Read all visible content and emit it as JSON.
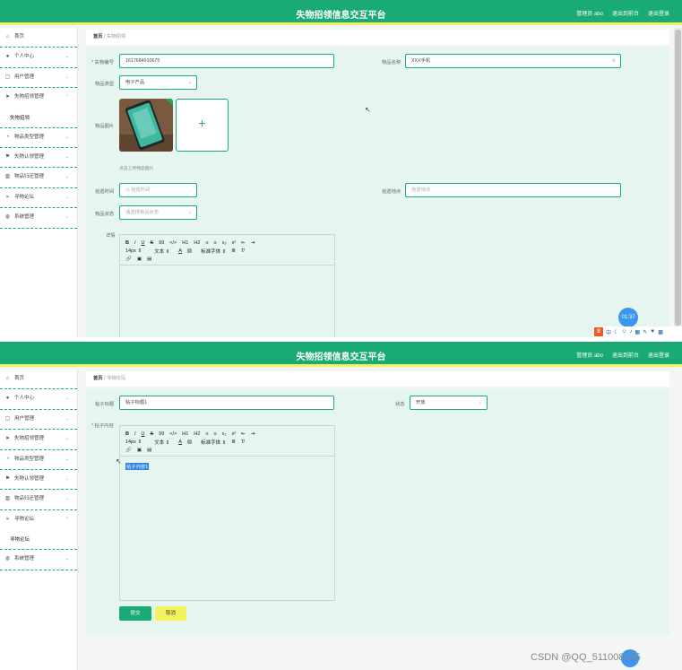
{
  "app": {
    "title": "失物招领信息交互平台",
    "admin_label": "管理员 abo",
    "back_label": "退出到前台",
    "logout_label": "退出登录"
  },
  "sidebar_items": [
    "首页",
    "个人中心",
    "用户管理",
    "失物招领管理",
    "物品类型管理",
    "失物认领管理",
    "物品归还管理",
    "寻物论坛",
    "系统管理"
  ],
  "screen1": {
    "breadcrumb": {
      "home": "首页",
      "current": "失物招领"
    },
    "submenu": "失物招领",
    "form": {
      "lost_no_label": "失物编号",
      "lost_no_value": "1617684910675",
      "item_name_label": "物品名称",
      "item_name_value": "XXX手机",
      "item_type_label": "物品类型",
      "item_type_value": "电子产品",
      "item_image_label": "物品图片",
      "upload_hint": "点击上传物品图片",
      "pickup_time_label": "拾遗时间",
      "pickup_time_placeholder": "拾遗时间",
      "pickup_place_label": "拾遗地点",
      "pickup_place_placeholder": "拾遗地点",
      "item_status_label": "物品状态",
      "item_status_placeholder": "请选择物品状态",
      "detail_label": "详情"
    },
    "timer": "01:37",
    "tray_icons": [
      "sougou-icon",
      "中",
      "moon-icon",
      "smile-icon",
      "mic-icon",
      "keyboard-icon",
      "brush-icon",
      "shirt-icon",
      "grid-icon"
    ]
  },
  "screen2": {
    "breadcrumb": {
      "home": "首页",
      "current": "寻物论坛"
    },
    "submenu": "寻物论坛",
    "form": {
      "post_title_label": "帖子标题",
      "post_title_value": "帖子标题1",
      "status_label": "状态",
      "status_value": "开放",
      "post_content_label": "帖子内容",
      "post_content_value": "帖子内容1",
      "submit_label": "提交",
      "cancel_label": "取消"
    },
    "watermark": "CSDN @QQ_511008285"
  },
  "editor_toolbar": {
    "row1": [
      "B",
      "I",
      "U",
      "S",
      "99",
      "</>",
      "H1",
      "H2",
      "≡",
      "≡",
      "x₂",
      "x²",
      "⇤",
      "⇥"
    ],
    "font_size": "14px",
    "text_style": "文本",
    "font_family": "标准字体"
  },
  "colors": {
    "brand": "#1aaa76",
    "accent_yellow": "#f4f25a",
    "panel_bg": "#e6f5ef",
    "badge_blue": "#3b96f1"
  }
}
